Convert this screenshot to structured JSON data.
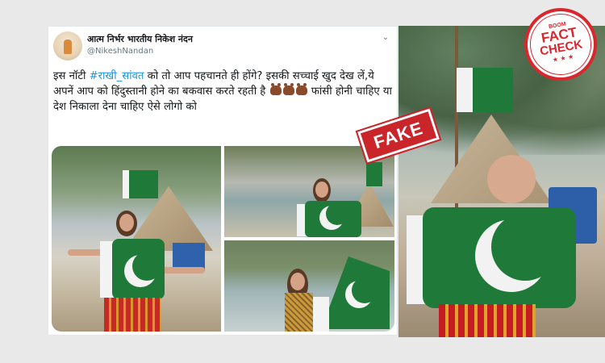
{
  "tweet": {
    "display_name": "आत्म निर्भर भारतीय निकेश नंदन",
    "handle": "@NikeshNandan",
    "text_part1": "इस नॉटी ",
    "hashtag": "#राखी_सांवत",
    "text_part2": " को तो आप पहचानते ही होंगे? इसकी सच्चाई खुद देख लें,ये अपनें आप को हिंदुस्तानी होने का बकवास करते रहती है ",
    "text_part3": " फांसी होनी चाहिए या देश निकाला देना चाहिए ऐसे लोगो को",
    "emoji_name": "boar-emoji",
    "menu_icon": "chevron-down-icon"
  },
  "stamp": {
    "label": "FAKE"
  },
  "badge": {
    "top": "BOOM",
    "line1": "FACT",
    "line2": "CHECK",
    "stars": "★ ★ ★"
  },
  "colors": {
    "hashtag": "#1b95e0",
    "stamp_red": "#c9252b",
    "flag_green": "#1f7a3a"
  }
}
